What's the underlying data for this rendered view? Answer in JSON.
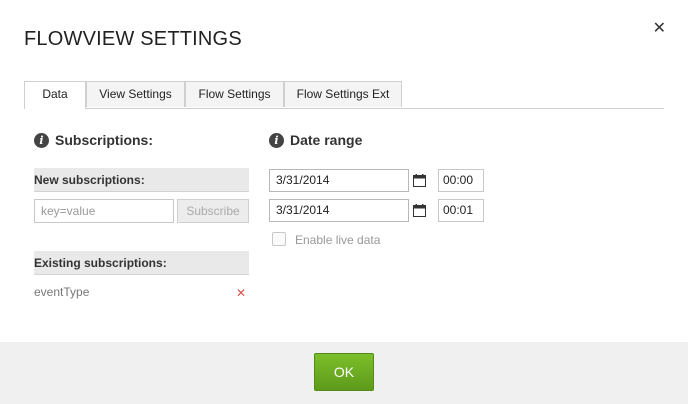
{
  "dialog": {
    "title": "FLOWVIEW SETTINGS",
    "close_glyph": "✕"
  },
  "tabs": [
    {
      "label": "Data",
      "active": true
    },
    {
      "label": "View Settings",
      "active": false
    },
    {
      "label": "Flow Settings",
      "active": false
    },
    {
      "label": "Flow Settings Ext",
      "active": false
    }
  ],
  "subscriptions": {
    "heading": "Subscriptions:",
    "info_glyph": "i",
    "new_label": "New subscriptions:",
    "input_placeholder": "key=value",
    "subscribe_label": "Subscribe",
    "existing_label": "Existing subscriptions:",
    "existing_items": [
      {
        "name": "eventType",
        "remove_glyph": "✕"
      }
    ]
  },
  "date_range": {
    "heading": "Date range",
    "info_glyph": "i",
    "from_date": "3/31/2014",
    "from_time": "00:00",
    "to_date": "3/31/2014",
    "to_time": "00:01",
    "live_label": "Enable live data",
    "live_checked": false
  },
  "footer": {
    "ok_label": "OK"
  },
  "colors": {
    "ok_button": "#6aab22",
    "remove_icon": "#d9534f",
    "footer_bg": "#f0f0f0"
  },
  "icons": {
    "close": "close-icon",
    "info": "info-icon",
    "calendar": "calendar-icon",
    "remove": "remove-icon"
  }
}
